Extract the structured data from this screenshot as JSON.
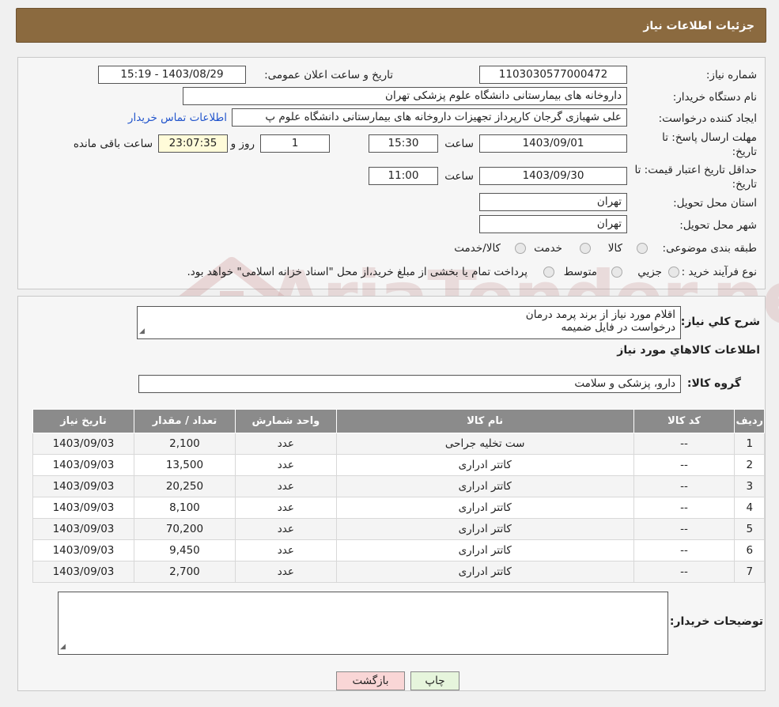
{
  "header": {
    "title": "جزئیات اطلاعات نیاز"
  },
  "fields": {
    "need_number_label": "شماره نیاز:",
    "need_number": "1103030577000472",
    "announce_label": "تاریخ و ساعت اعلان عمومی:",
    "announce_value": "1403/08/29 - 15:19",
    "buyer_org_label": "نام دستگاه خریدار:",
    "buyer_org": "داروخانه های بیمارستانی دانشگاه علوم پزشکی تهران",
    "creator_label": "ایجاد کننده درخواست:",
    "creator": "علی شهبازی گرجان کارپرداز تجهیزات داروخانه های بیمارستانی دانشگاه علوم پ",
    "contact_link": "اطلاعات تماس خریدار",
    "deadline_label_1": "مهلت ارسال پاسخ: تا",
    "deadline_label_2": "تاریخ:",
    "deadline_date": "1403/09/01",
    "time_label": "ساعت",
    "deadline_time": "15:30",
    "days_value": "1",
    "days_label": "روز و",
    "remaining_time": "23:07:35",
    "remaining_label": "ساعت باقی مانده",
    "validity_label_1": "حداقل تاریخ اعتبار قیمت: تا",
    "validity_label_2": "تاریخ:",
    "validity_date": "1403/09/30",
    "validity_time": "11:00",
    "province_label": "استان محل تحویل:",
    "province": "تهران",
    "city_label": "شهر محل تحویل:",
    "city": "تهران",
    "category_label": "طبقه بندی موضوعی:",
    "category_options": [
      "کالا",
      "خدمت",
      "کالا/خدمت"
    ],
    "purchase_type_label": "نوع فرآیند خرید :",
    "purchase_options": [
      "جزیي",
      "متوسط"
    ],
    "purchase_note": "پرداخت تمام یا بخشی از مبلغ خرید،از محل \"اسناد خزانه اسلامی\" خواهد بود."
  },
  "watermark": "AriaTender.neT",
  "details": {
    "description_label": "شرح کلي نياز:",
    "description_lines": [
      "اقلام مورد نیاز از برند پرمد درمان",
      "درخواست در فایل ضمیمه"
    ],
    "goods_info_title": "اطلاعات کالاهاي مورد نياز",
    "goods_group_label": "گروه کالا:",
    "goods_group": "دارو، پزشکی و سلامت",
    "table": {
      "headers": [
        "رديف",
        "کد کالا",
        "نام کالا",
        "واحد شمارش",
        "تعداد / مقدار",
        "تاريخ نياز"
      ],
      "rows": [
        [
          "1",
          "--",
          "ست تخلیه جراحی",
          "عدد",
          "2,100",
          "1403/09/03"
        ],
        [
          "2",
          "--",
          "کاتتر ادراری",
          "عدد",
          "13,500",
          "1403/09/03"
        ],
        [
          "3",
          "--",
          "کاتتر ادراری",
          "عدد",
          "20,250",
          "1403/09/03"
        ],
        [
          "4",
          "--",
          "کاتتر ادراری",
          "عدد",
          "8,100",
          "1403/09/03"
        ],
        [
          "5",
          "--",
          "کاتتر ادراری",
          "عدد",
          "70,200",
          "1403/09/03"
        ],
        [
          "6",
          "--",
          "کاتتر ادراری",
          "عدد",
          "9,450",
          "1403/09/03"
        ],
        [
          "7",
          "--",
          "کاتتر ادراری",
          "عدد",
          "2,700",
          "1403/09/03"
        ]
      ]
    },
    "buyer_notes_label": "توضیحات خریدار:"
  },
  "buttons": {
    "print": "چاپ",
    "back": "بازگشت"
  },
  "colors": {
    "header_bg": "#8b6a3f",
    "table_header_bg": "#8b8b8b",
    "link": "#2255cc",
    "back_button_bg": "#f9d6d6",
    "print_button_bg": "#e6f5dc"
  }
}
